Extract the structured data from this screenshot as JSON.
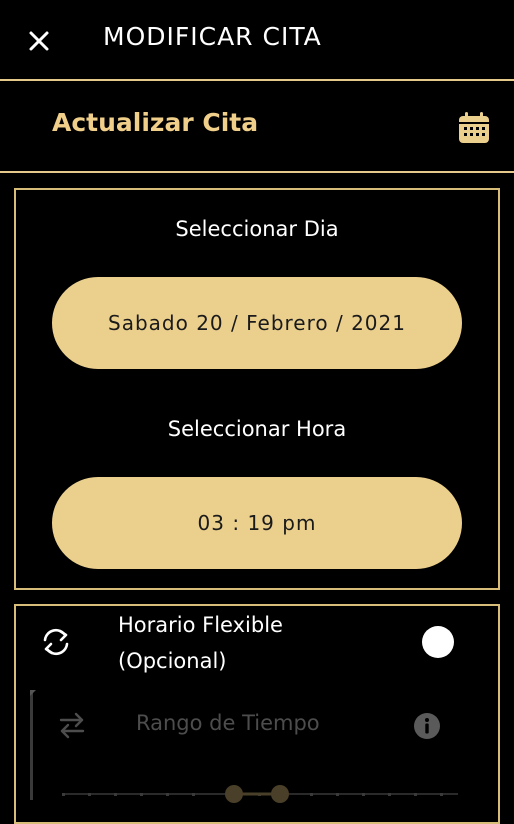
{
  "header": {
    "title": "MODIFICAR CITA",
    "close_icon": "close-icon"
  },
  "section": {
    "title": "Actualizar Cita",
    "calendar_icon": "calendar-icon"
  },
  "date_card": {
    "day_label": "Seleccionar Dia",
    "day_value": "Sabado 20 / Febrero / 2021",
    "time_label": "Seleccionar Hora",
    "time_value": "03 : 19 pm"
  },
  "flexible": {
    "label_line1": "Horario Flexible",
    "label_line2": "(Opcional)",
    "icon": "refresh-icon",
    "toggle_on": false
  },
  "range": {
    "label": "Rango de Tiempo",
    "swap_icon": "swap-icon",
    "info_icon": "info-icon"
  },
  "colors": {
    "accent": "#ebcf8d",
    "accent_text": "#f0cf8a",
    "border": "#d8bd78",
    "background": "#000000"
  }
}
